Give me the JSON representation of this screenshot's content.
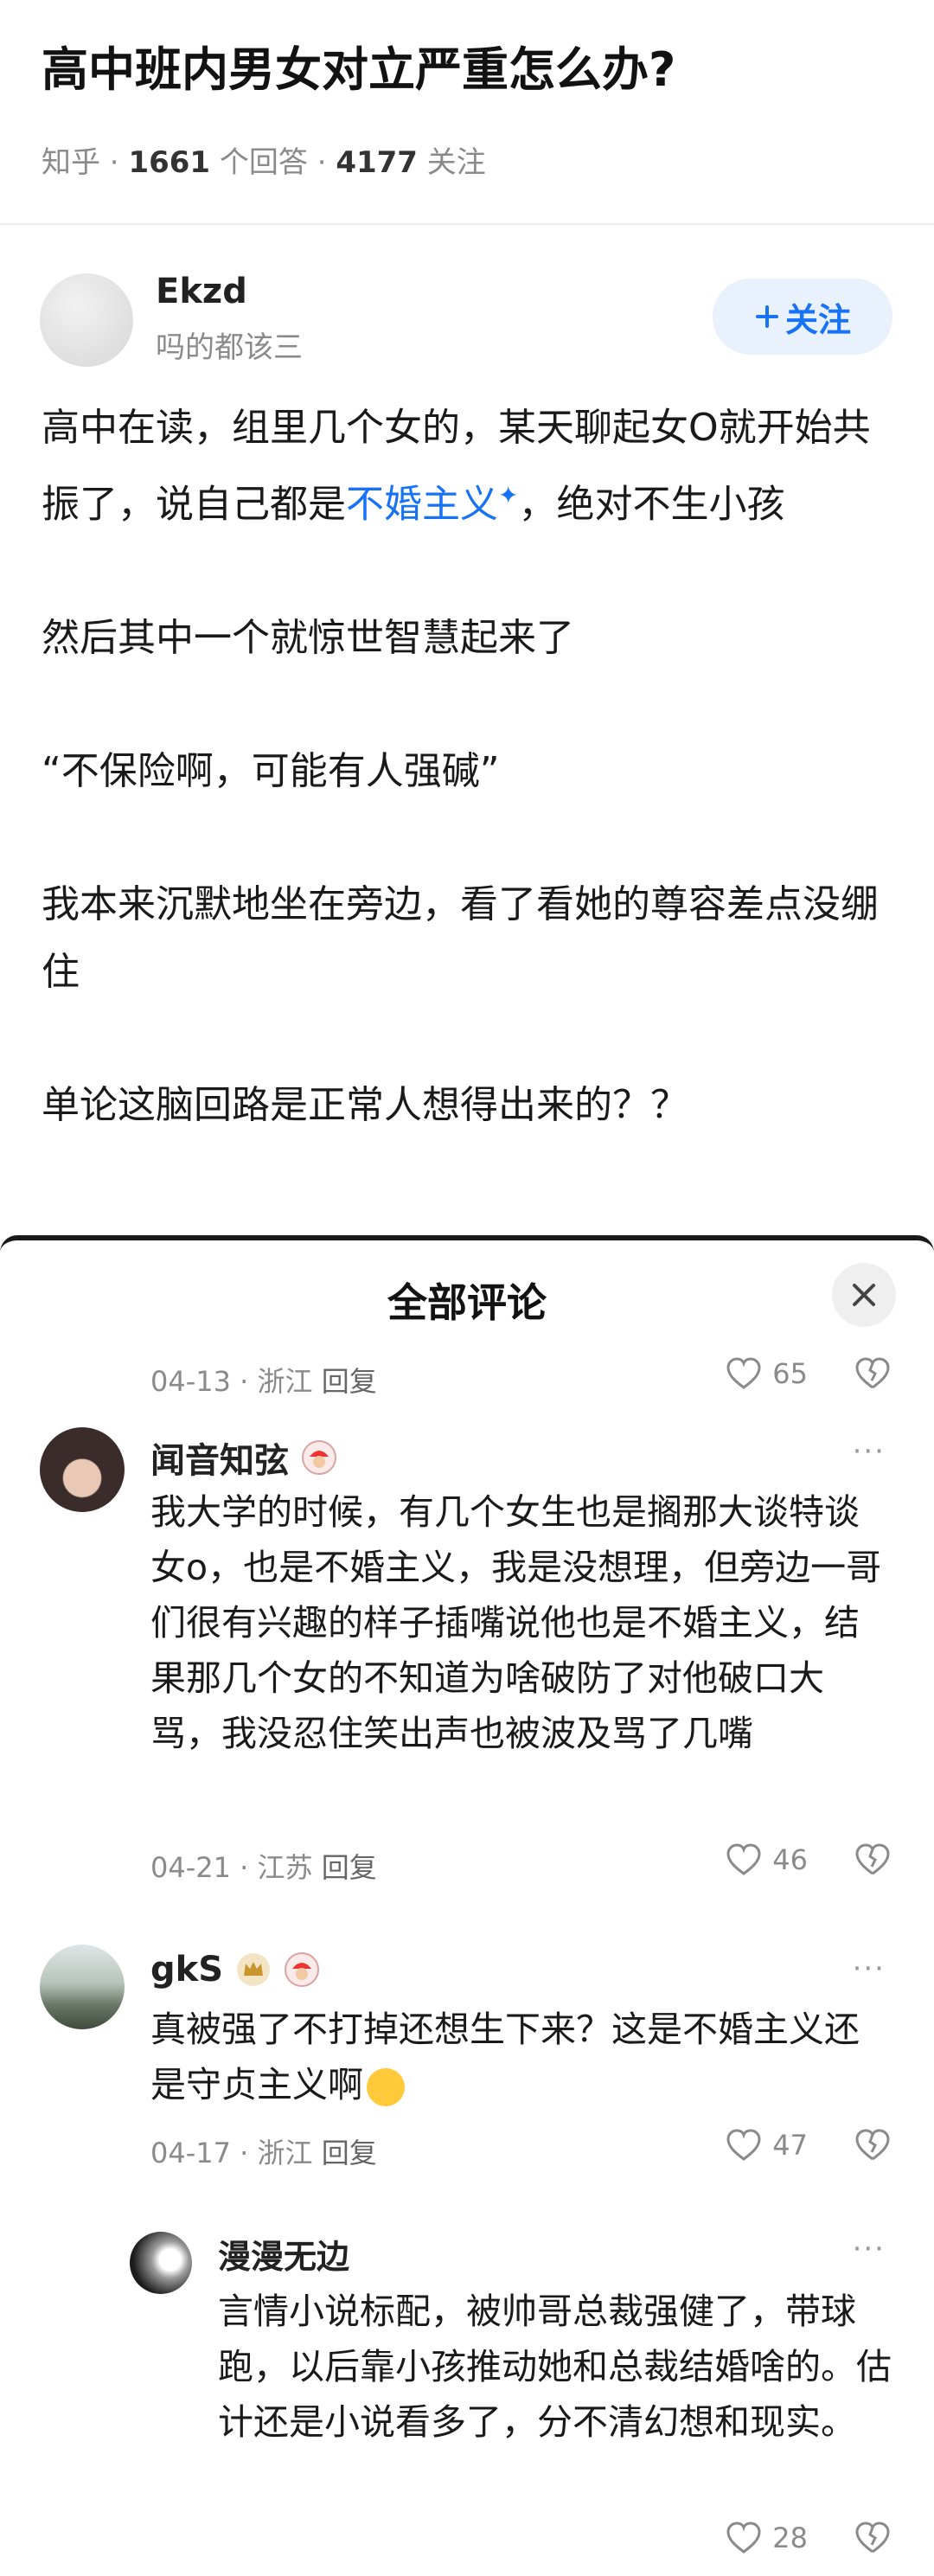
{
  "question": {
    "title": "高中班内男女对立严重怎么办?",
    "source": "知乎",
    "answer_count": "1661",
    "answer_label": "个回答",
    "follow_count": "4177",
    "follow_label": "关注"
  },
  "answer": {
    "author": "Ekzd",
    "author_bio": "吗的都该三",
    "follow_button": "关注",
    "p1_before": "高中在读，组里几个女的，某天聊起女O就开始共振了，说自己都是",
    "p1_keyword": "不婚主义",
    "p1_after": "，绝对不生小孩",
    "p2": "然后其中一个就惊世智慧起来了",
    "p3": "“不保险啊，可能有人强碱”",
    "p4": "我本来沉默地坐在旁边，看了看她的尊容差点没绷住",
    "p5": "单论这脑回路是正常人想得出来的？？"
  },
  "comments_sheet": {
    "title": "全部评论",
    "top_meta": {
      "date": "04-13",
      "location": "浙江",
      "reply": "回复",
      "likes": "65"
    },
    "comments": [
      {
        "name": "闻音知弦",
        "text": "我大学的时候，有几个女生也是搁那大谈特谈女o，也是不婚主义，我是没想理，但旁边一哥们很有兴趣的样子插嘴说他也是不婚主义，结果那几个女的不知道为啥破防了对他破口大骂，我没忍住笑出声也被波及骂了几嘴",
        "date": "04-21",
        "location": "江苏",
        "reply": "回复",
        "likes": "46"
      },
      {
        "name": "gkS",
        "text": "真被强了不打掉还想生下来？这是不婚主义还是守贞主义啊",
        "date": "04-17",
        "location": "浙江",
        "reply": "回复",
        "likes": "47"
      }
    ],
    "sub_comment": {
      "name": "漫漫无边",
      "text": "言情小说标配，被帅哥总裁强健了，带球跑，以后靠小孩推动她和总裁结婚啥的。估计还是小说看多了，分不清幻想和现实。",
      "likes": "28"
    },
    "more_label": "···"
  },
  "colors": {
    "accent": "#1772f6",
    "muted": "#8a8a8a"
  }
}
